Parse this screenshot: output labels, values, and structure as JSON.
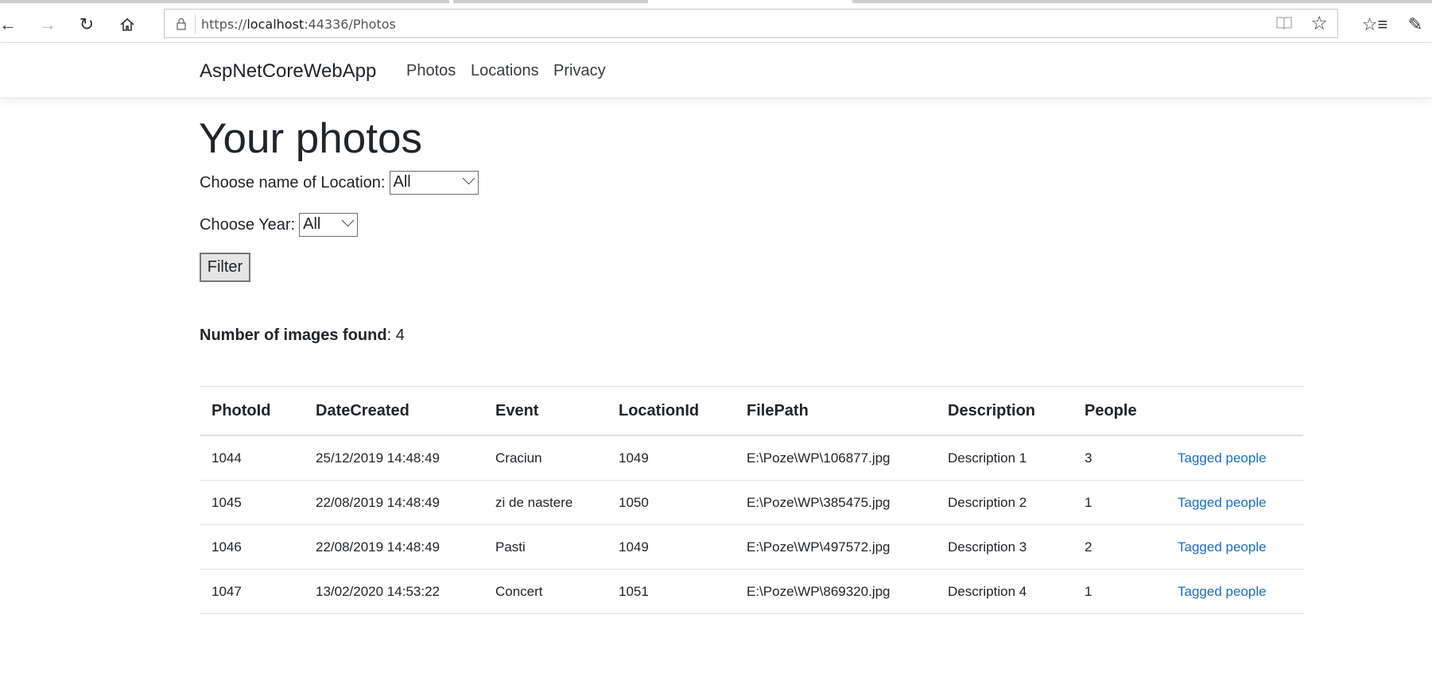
{
  "browser": {
    "url_prefix": "https://",
    "url_host": "localhost",
    "url_rest": ":44336/Photos"
  },
  "navbar": {
    "brand": "AspNetCoreWebApp",
    "links": [
      "Photos",
      "Locations",
      "Privacy"
    ]
  },
  "main": {
    "title": "Your photos",
    "location_label": "Choose name of Location:",
    "location_selected": "All",
    "year_label": "Choose Year:",
    "year_selected": "All",
    "filter_button": "Filter",
    "count_label": "Number of images found",
    "count_suffix": ": 4"
  },
  "table": {
    "headers": [
      "PhotoId",
      "DateCreated",
      "Event",
      "LocationId",
      "FilePath",
      "Description",
      "People",
      ""
    ],
    "rows": [
      [
        "1044",
        "25/12/2019 14:48:49",
        "Craciun",
        "1049",
        "E:\\Poze\\WP\\106877.jpg",
        "Description 1",
        "3",
        "Tagged people"
      ],
      [
        "1045",
        "22/08/2019 14:48:49",
        "zi de nastere",
        "1050",
        "E:\\Poze\\WP\\385475.jpg",
        "Description 2",
        "1",
        "Tagged people"
      ],
      [
        "1046",
        "22/08/2019 14:48:49",
        "Pasti",
        "1049",
        "E:\\Poze\\WP\\497572.jpg",
        "Description 3",
        "2",
        "Tagged people"
      ],
      [
        "1047",
        "13/02/2020 14:53:22",
        "Concert",
        "1051",
        "E:\\Poze\\WP\\869320.jpg",
        "Description 4",
        "1",
        "Tagged people"
      ]
    ]
  },
  "colors": {
    "link": "#1b6ec2",
    "text": "#212529"
  }
}
